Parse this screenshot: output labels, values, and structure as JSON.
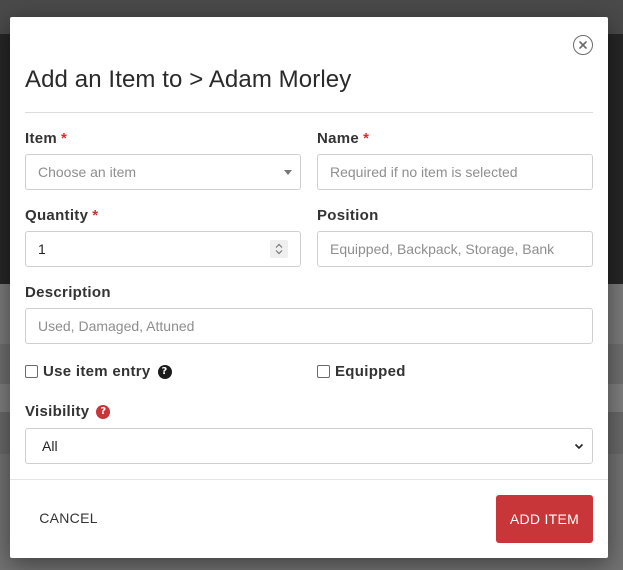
{
  "dialog": {
    "title": "Add an Item to > Adam Morley"
  },
  "form": {
    "required_marker": "*",
    "item": {
      "label": "Item",
      "placeholder": "Choose an item"
    },
    "name": {
      "label": "Name",
      "placeholder": "Required if no item is selected"
    },
    "quantity": {
      "label": "Quantity",
      "value": "1"
    },
    "position": {
      "label": "Position",
      "placeholder": "Equipped, Backpack, Storage, Bank"
    },
    "description": {
      "label": "Description",
      "placeholder": "Used, Damaged, Attuned"
    },
    "use_item_entry": {
      "label": "Use item entry",
      "checked": false,
      "help_glyph": "?"
    },
    "equipped": {
      "label": "Equipped",
      "checked": false
    },
    "visibility": {
      "label": "Visibility",
      "value": "All",
      "help_glyph": "?"
    }
  },
  "footer": {
    "cancel_label": "CANCEL",
    "add_label": "ADD ITEM"
  },
  "colors": {
    "accent": "#c9363a",
    "required": "#d32f2f"
  },
  "icons": [
    "close-icon",
    "caret-down-icon",
    "spinner-icon",
    "chevron-down-icon",
    "help-icon"
  ]
}
